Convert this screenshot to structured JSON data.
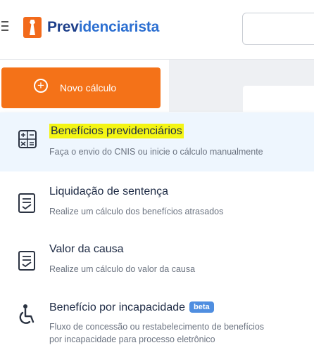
{
  "header": {
    "logo_part1": "Prev",
    "logo_part2": "idenciarista"
  },
  "new_calc": {
    "label": "Novo cálculo"
  },
  "menu": {
    "items": [
      {
        "title": "Benefícios previdenciários",
        "desc": "Faça o envio do CNIS ou inicie o cálculo manualmente",
        "icon": "calculator-icon"
      },
      {
        "title": "Liquidação de sentença",
        "desc": "Realize um cálculo dos benefícios atrasados",
        "icon": "document-icon"
      },
      {
        "title": "Valor da causa",
        "desc": "Realize um cálculo do valor da causa",
        "icon": "document-icon"
      },
      {
        "title": "Benefício por incapacidade",
        "badge": "beta",
        "desc_line1": "Fluxo de concessão ou restabelecimento de benefícios",
        "desc_line2": "por incapacidade para processo eletrônico",
        "icon": "wheelchair-icon"
      }
    ]
  },
  "colors": {
    "accent": "#f47218",
    "brand_dark": "#1d3f8a",
    "brand_light": "#2c6fd1",
    "highlight": "#f4f514",
    "badge": "#4f8ee0"
  }
}
